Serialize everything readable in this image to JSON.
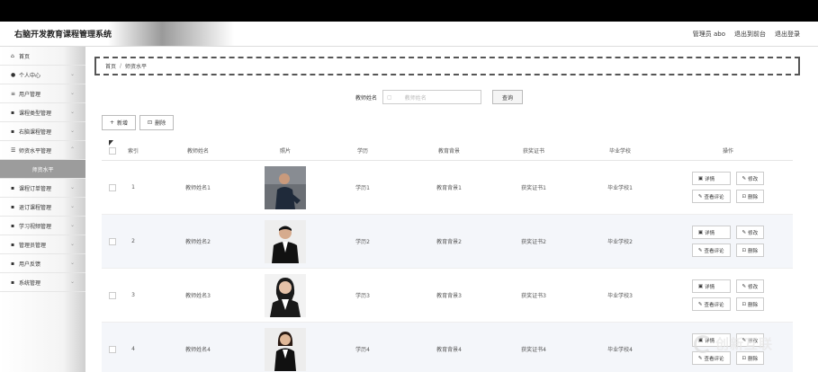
{
  "app": {
    "title": "右脑开发教育课程管理系统",
    "user_label": "管理员 abo",
    "back_front": "退出到前台",
    "logout": "退出登录"
  },
  "sidebar": {
    "items": [
      {
        "label": "首页",
        "icon": "home-icon",
        "glyph": "⌂",
        "chevron": false
      },
      {
        "label": "个人中心",
        "icon": "person-icon",
        "glyph": "👤",
        "chevron": true
      },
      {
        "label": "用户管理",
        "icon": "list-icon",
        "glyph": "≡",
        "chevron": true
      },
      {
        "label": "课程类型管理",
        "icon": "grid-icon",
        "glyph": "▪",
        "chevron": true
      },
      {
        "label": "右脑课程管理",
        "icon": "grid-icon",
        "glyph": "▪",
        "chevron": true
      },
      {
        "label": "师资水平管理",
        "icon": "sliders-icon",
        "glyph": "☰",
        "chevron": true
      },
      {
        "label": "师资水平",
        "sub": true
      },
      {
        "label": "课程订单管理",
        "icon": "grid-icon",
        "glyph": "▪",
        "chevron": true
      },
      {
        "label": "退订课程管理",
        "icon": "doc-icon",
        "glyph": "▪",
        "chevron": true
      },
      {
        "label": "学习视频管理",
        "icon": "grid-icon",
        "glyph": "▪",
        "chevron": true
      },
      {
        "label": "管理员管理",
        "icon": "admin-icon",
        "glyph": "▪",
        "chevron": true
      },
      {
        "label": "用户反馈",
        "icon": "grid-icon",
        "glyph": "▪",
        "chevron": true
      },
      {
        "label": "系统管理",
        "icon": "grid-icon",
        "glyph": "▪",
        "chevron": true
      }
    ]
  },
  "breadcrumb": {
    "home": "首页",
    "sep": "/",
    "current": "师资水平"
  },
  "search": {
    "label": "教师姓名",
    "placeholder": "教师姓名",
    "button": "查询"
  },
  "actions": {
    "add": "新增",
    "delete": "删除"
  },
  "table": {
    "headers": {
      "index": "索引",
      "name": "教师姓名",
      "photo": "照片",
      "edu": "学历",
      "background": "教育背景",
      "cert": "获奖证书",
      "school": "毕业学校",
      "ops": "操作"
    },
    "rows": [
      {
        "index": "1",
        "name": "教师姓名1",
        "edu": "学历1",
        "background": "教育背景1",
        "cert": "获奖证书1",
        "school": "毕业学校1"
      },
      {
        "index": "2",
        "name": "教师姓名2",
        "edu": "学历2",
        "background": "教育背景2",
        "cert": "获奖证书2",
        "school": "毕业学校2"
      },
      {
        "index": "3",
        "name": "教师姓名3",
        "edu": "学历3",
        "background": "教育背景3",
        "cert": "获奖证书3",
        "school": "毕业学校3"
      },
      {
        "index": "4",
        "name": "教师姓名4",
        "edu": "学历4",
        "background": "教育背景4",
        "cert": "获奖证书4",
        "school": "毕业学校4"
      }
    ],
    "ops": {
      "detail": "详情",
      "edit": "修改",
      "comments": "查看评论",
      "delete": "删除"
    }
  },
  "watermark": {
    "text": "创新互联"
  }
}
